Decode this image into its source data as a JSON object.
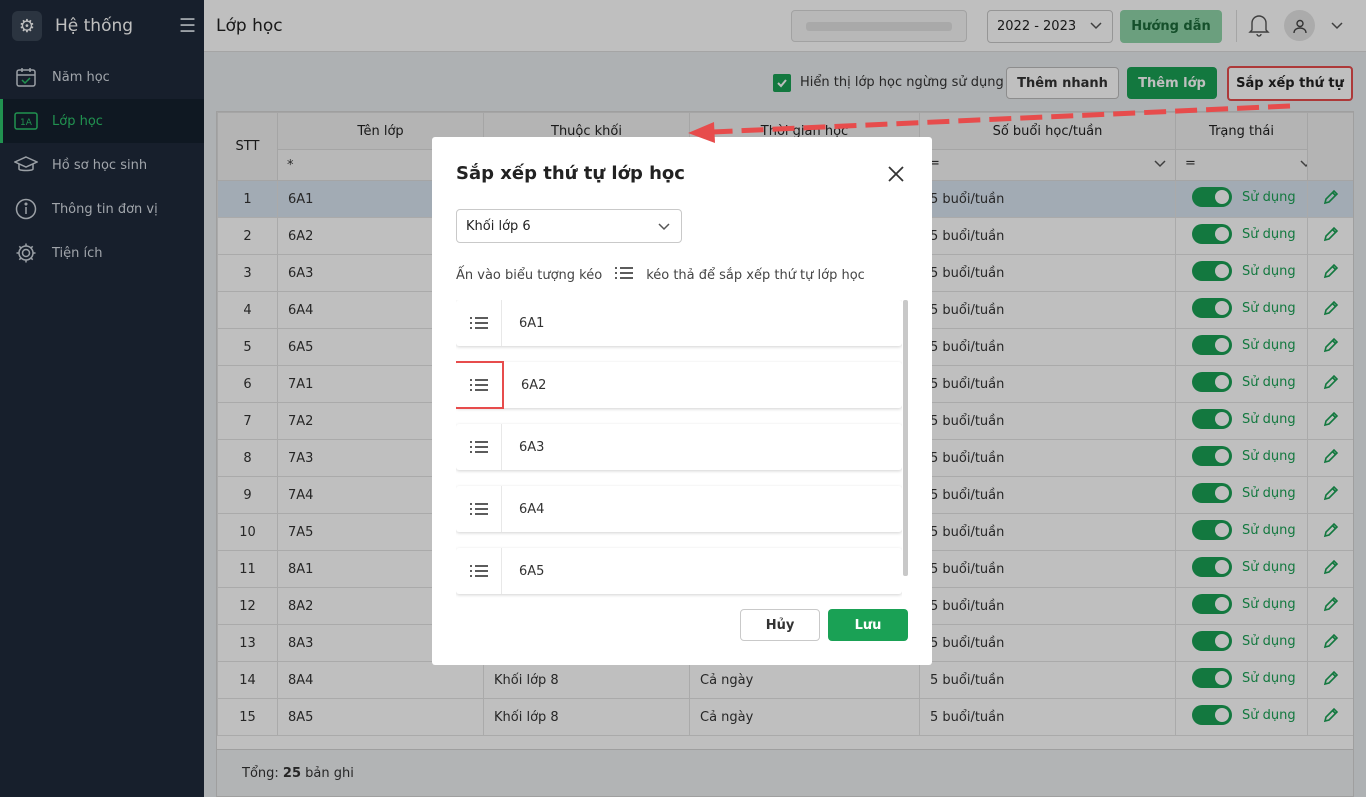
{
  "sidebar": {
    "title": "Hệ thống",
    "items": [
      {
        "label": "Năm học",
        "icon": "calendar-icon"
      },
      {
        "label": "Lớp học",
        "icon": "class-badge-icon",
        "badge": "1A"
      },
      {
        "label": "Hồ sơ học sinh",
        "icon": "graduation-cap-icon"
      },
      {
        "label": "Thông tin đơn vị",
        "icon": "info-icon"
      },
      {
        "label": "Tiện ích",
        "icon": "gear-icon"
      }
    ]
  },
  "topbar": {
    "page_title": "Lớp học",
    "school_year": "2022 - 2023",
    "guide": "Hướng dẫn"
  },
  "toolbar": {
    "show_inactive": "Hiển thị lớp học ngừng sử dụng",
    "quick_add": "Thêm nhanh",
    "add_class": "Thêm lớp",
    "sort_order": "Sắp xếp thứ tự"
  },
  "table": {
    "headers": [
      "STT",
      "Tên lớp",
      "Thuộc khối",
      "Thời gian học",
      "Số buổi học/tuần",
      "Trạng thái"
    ],
    "filters": {
      "name_op": "*",
      "sessions_op": "=",
      "status_op": "="
    },
    "rows": [
      {
        "stt": "1",
        "name": "6A1",
        "grade": "",
        "time": "",
        "sessions": "5 buổi/tuần",
        "status": "Sử dụng"
      },
      {
        "stt": "2",
        "name": "6A2",
        "grade": "",
        "time": "",
        "sessions": "5 buổi/tuần",
        "status": "Sử dụng"
      },
      {
        "stt": "3",
        "name": "6A3",
        "grade": "",
        "time": "",
        "sessions": "5 buổi/tuần",
        "status": "Sử dụng"
      },
      {
        "stt": "4",
        "name": "6A4",
        "grade": "",
        "time": "",
        "sessions": "5 buổi/tuần",
        "status": "Sử dụng"
      },
      {
        "stt": "5",
        "name": "6A5",
        "grade": "",
        "time": "",
        "sessions": "5 buổi/tuần",
        "status": "Sử dụng"
      },
      {
        "stt": "6",
        "name": "7A1",
        "grade": "",
        "time": "",
        "sessions": "5 buổi/tuần",
        "status": "Sử dụng"
      },
      {
        "stt": "7",
        "name": "7A2",
        "grade": "",
        "time": "",
        "sessions": "5 buổi/tuần",
        "status": "Sử dụng"
      },
      {
        "stt": "8",
        "name": "7A3",
        "grade": "",
        "time": "",
        "sessions": "5 buổi/tuần",
        "status": "Sử dụng"
      },
      {
        "stt": "9",
        "name": "7A4",
        "grade": "",
        "time": "",
        "sessions": "5 buổi/tuần",
        "status": "Sử dụng"
      },
      {
        "stt": "10",
        "name": "7A5",
        "grade": "",
        "time": "",
        "sessions": "5 buổi/tuần",
        "status": "Sử dụng"
      },
      {
        "stt": "11",
        "name": "8A1",
        "grade": "",
        "time": "",
        "sessions": "5 buổi/tuần",
        "status": "Sử dụng"
      },
      {
        "stt": "12",
        "name": "8A2",
        "grade": "",
        "time": "",
        "sessions": "5 buổi/tuần",
        "status": "Sử dụng"
      },
      {
        "stt": "13",
        "name": "8A3",
        "grade": "",
        "time": "",
        "sessions": "5 buổi/tuần",
        "status": "Sử dụng"
      },
      {
        "stt": "14",
        "name": "8A4",
        "grade": "Khối lớp 8",
        "time": "Cả ngày",
        "sessions": "5 buổi/tuần",
        "status": "Sử dụng"
      },
      {
        "stt": "15",
        "name": "8A5",
        "grade": "Khối lớp 8",
        "time": "Cả ngày",
        "sessions": "5 buổi/tuần",
        "status": "Sử dụng"
      }
    ]
  },
  "footer": {
    "total_label": "Tổng:",
    "total_count": "25",
    "total_suffix": "bản ghi"
  },
  "modal": {
    "title": "Sắp xếp thứ tự lớp học",
    "grade_select": "Khối lớp 6",
    "hint_before": "Ấn vào biểu tượng kéo",
    "hint_after": "kéo thả để sắp xếp thứ tự lớp học",
    "items": [
      "6A1",
      "6A2",
      "6A3",
      "6A4",
      "6A5"
    ],
    "cancel": "Hủy",
    "save": "Lưu"
  },
  "colors": {
    "accent": "#1aa155",
    "highlight": "#e74c4c",
    "sidebar": "#1f2a3b"
  }
}
